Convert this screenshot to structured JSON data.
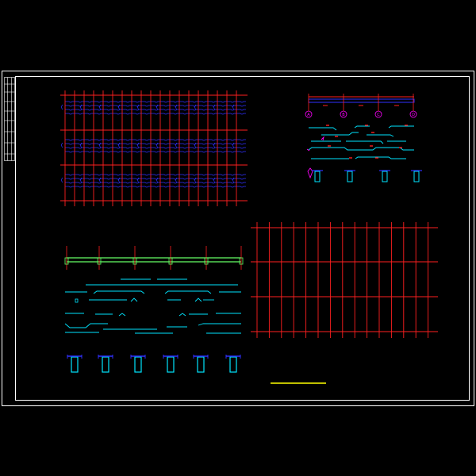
{
  "colors": {
    "background": "#000000",
    "frame": "#ffffff",
    "grid": "#ff2020",
    "rebar": "#3030ff",
    "detail": "#00e5ff",
    "annotation": "#ff00ff",
    "beam": "#66ff66",
    "scale_bar": "#ffff00"
  },
  "section_top_right": {
    "axis_labels": [
      "A",
      "B",
      "C",
      "D"
    ]
  }
}
